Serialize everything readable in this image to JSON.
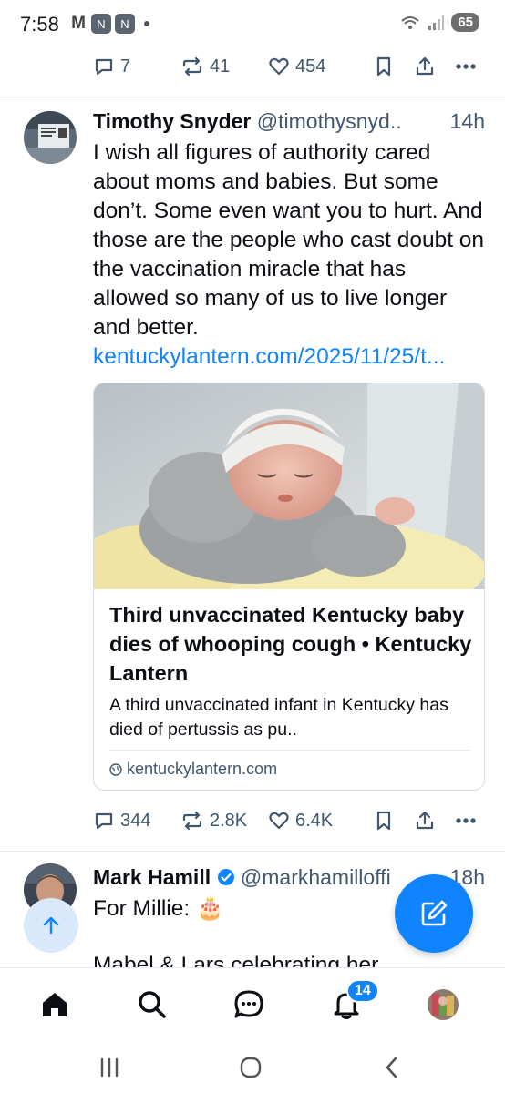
{
  "status_bar": {
    "time": "7:58",
    "app_icons": [
      "gmail-icon",
      "app-icon",
      "app-icon"
    ],
    "battery": "65"
  },
  "prev_post_actions": {
    "replies": "7",
    "reposts": "41",
    "likes": "454"
  },
  "post": {
    "author_name": "Timothy Snyder",
    "handle": "@timothysnyd..",
    "time": "14h",
    "text": "I wish all figures of authority cared about moms and babies. But some don’t. Some even want you to hurt. And those are the people who cast doubt on the vaccination miracle that has allowed so many of us to live longer and better.",
    "link": "kentuckylantern.com/2025/11/25/t...",
    "card": {
      "title": "Third unvaccinated Kentucky baby dies of whooping cough • Kentucky Lantern",
      "description": "A third unvaccinated infant in Kentucky has died of pertussis as pu..",
      "domain": "kentuckylantern.com"
    },
    "actions": {
      "replies": "344",
      "reposts": "2.8K",
      "likes": "6.4K"
    }
  },
  "next_post": {
    "author_name": "Mark Hamill",
    "handle": "@markhamilloffi",
    "time": "18h",
    "text": "For Millie: 🎂",
    "text_partial": "Mabel & Lars celebrating her"
  },
  "bottom_nav": {
    "notification_count": "14"
  },
  "colors": {
    "accent": "#1083fe",
    "muted_text": "#42576e",
    "divider": "#e4e9ee"
  }
}
